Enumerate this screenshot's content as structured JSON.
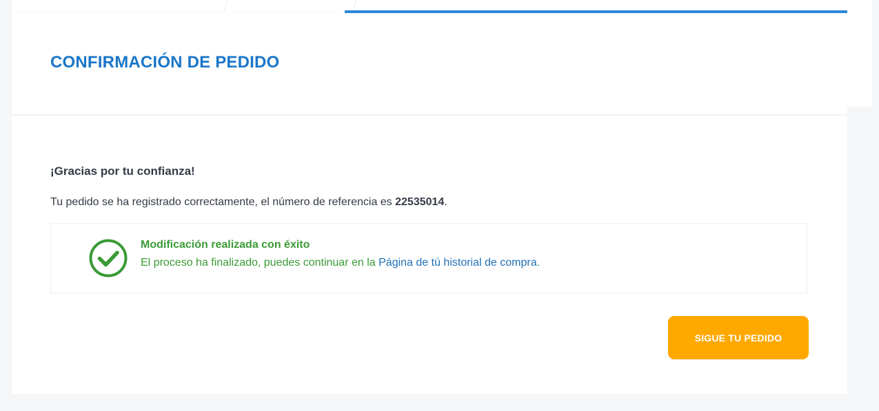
{
  "header": {
    "title": "CONFIRMACIÓN DE PEDIDO"
  },
  "confirmation": {
    "thanks": "¡Gracias por tu confianza!",
    "reference_prefix": "Tu pedido se ha registrado correctamente, el número de referencia es ",
    "reference_number": "22535014",
    "reference_suffix": "."
  },
  "success_message": {
    "icon": "check-circle-icon",
    "title": "Modificación realizada con éxito",
    "text_prefix": "El proceso ha finalizado, puedes continuar en la ",
    "link_label": "Página de tú historial de compra",
    "text_suffix": "."
  },
  "actions": {
    "track_button_label": "SIGUE TU PEDIDO"
  },
  "colors": {
    "accent_blue": "#1976c8",
    "tab_active": "#2b86d9",
    "success_green": "#3a9a35",
    "link_blue": "#1f6fb5",
    "button_orange": "#ffa800"
  }
}
